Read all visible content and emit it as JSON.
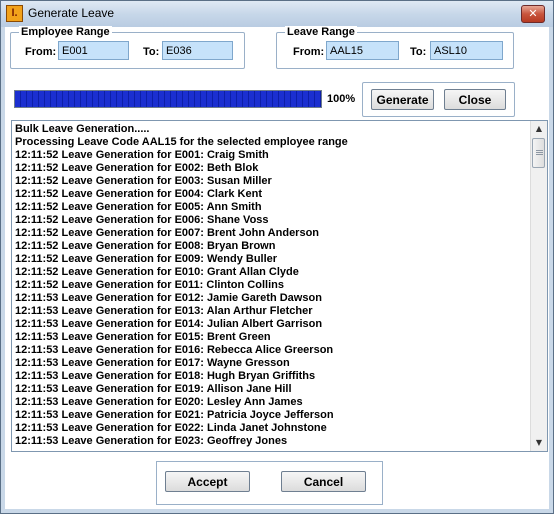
{
  "window": {
    "title": "Generate Leave",
    "app_icon": "app-logo-icon",
    "close_icon": "close-icon",
    "close_glyph": "✕"
  },
  "employee_range": {
    "caption": "Employee Range",
    "from_label": "From:",
    "from_value": "E001",
    "to_label": "To:",
    "to_value": "E036"
  },
  "leave_range": {
    "caption": "Leave Range",
    "from_label": "From:",
    "from_value": "AAL15",
    "to_label": "To:",
    "to_value": "ASL10"
  },
  "progress": {
    "value": 1.0,
    "text": "100%"
  },
  "buttons": {
    "generate": "Generate",
    "close": "Close",
    "accept": "Accept",
    "cancel": "Cancel"
  },
  "log": {
    "lines": [
      "Bulk Leave Generation.....",
      "Processing Leave Code AAL15 for the selected employee range",
      "12:11:52 Leave Generation for E001: Craig Smith",
      "12:11:52 Leave Generation for E002: Beth Blok",
      "12:11:52 Leave Generation for E003: Susan Miller",
      "12:11:52 Leave Generation for E004: Clark Kent",
      "12:11:52 Leave Generation for E005: Ann Smith",
      "12:11:52 Leave Generation for E006: Shane Voss",
      "12:11:52 Leave Generation for E007: Brent John Anderson",
      "12:11:52 Leave Generation for E008: Bryan Brown",
      "12:11:52 Leave Generation for E009: Wendy Buller",
      "12:11:52 Leave Generation for E010: Grant Allan Clyde",
      "12:11:52 Leave Generation for E011: Clinton Collins",
      "12:11:53 Leave Generation for E012: Jamie Gareth Dawson",
      "12:11:53 Leave Generation for E013: Alan Arthur Fletcher",
      "12:11:53 Leave Generation for E014: Julian Albert Garrison",
      "12:11:53 Leave Generation for E015: Brent Green",
      "12:11:53 Leave Generation for E016: Rebecca Alice Greerson",
      "12:11:53 Leave Generation for E017: Wayne Gresson",
      "12:11:53 Leave Generation for E018: Hugh Bryan Griffiths",
      "12:11:53 Leave Generation for E019: Allison Jane Hill",
      "12:11:53 Leave Generation for E020: Lesley Ann James",
      "12:11:53 Leave Generation for E021: Patricia Joyce Jefferson",
      "12:11:53 Leave Generation for E022: Linda Janet Johnstone",
      "12:11:53 Leave Generation for E023: Geoffrey Jones"
    ]
  },
  "scrollbar": {
    "up_glyph": "▲",
    "down_glyph": "▼"
  }
}
